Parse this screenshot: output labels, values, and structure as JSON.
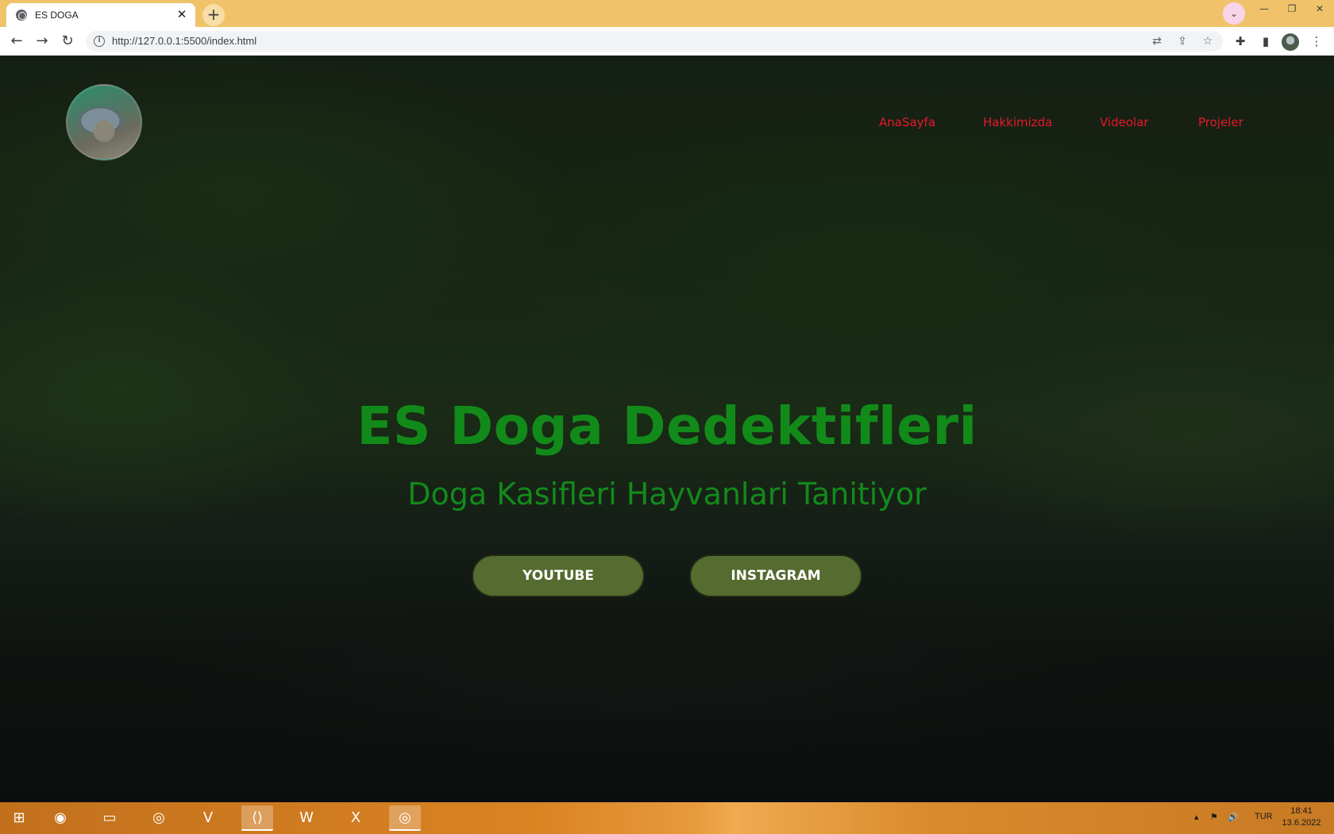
{
  "browser": {
    "tab_title": "ES DOGA",
    "url": "http://127.0.0.1:5500/index.html"
  },
  "site": {
    "nav": [
      "AnaSayfa",
      "Hakkimizda",
      "Videolar",
      "Projeler"
    ],
    "hero_title": "ES Doga Dedektifleri",
    "hero_subtitle": "Doga Kasifleri Hayvanlari Tanitiyor",
    "buttons": [
      "YOUTUBE",
      "INSTAGRAM"
    ],
    "colors": {
      "nav": "#e8172a",
      "hero_text": "#128a1a",
      "button_bg": "#556b2f"
    }
  },
  "taskbar": {
    "language": "TUR",
    "time": "18:41",
    "date": "13.6.2022"
  }
}
